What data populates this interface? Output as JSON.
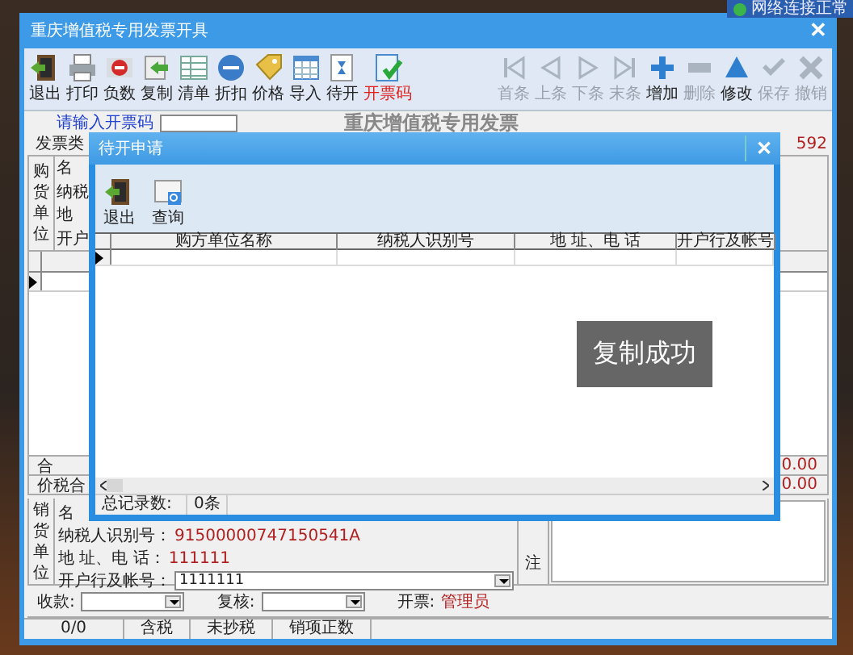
{
  "notification": {
    "text": "网络连接正常"
  },
  "main_window": {
    "title": "重庆增值税专用发票开具",
    "close_label": "✕",
    "toolbar": [
      {
        "label": "退出",
        "kind": "exit"
      },
      {
        "label": "打印",
        "kind": "print"
      },
      {
        "label": "负数",
        "kind": "negative"
      },
      {
        "label": "复制",
        "kind": "copy"
      },
      {
        "label": "清单",
        "kind": "list"
      },
      {
        "label": "折扣",
        "kind": "discount"
      },
      {
        "label": "价格",
        "kind": "price"
      },
      {
        "label": "导入",
        "kind": "import"
      },
      {
        "label": "待开",
        "kind": "pending"
      },
      {
        "label": "开票码",
        "kind": "code"
      }
    ],
    "nav": [
      {
        "label": "首条",
        "kind": "first",
        "disabled": true
      },
      {
        "label": "上条",
        "kind": "prev",
        "disabled": true
      },
      {
        "label": "下条",
        "kind": "next",
        "disabled": true
      },
      {
        "label": "末条",
        "kind": "last",
        "disabled": true
      },
      {
        "label": "增加",
        "kind": "add",
        "disabled": false
      },
      {
        "label": "删除",
        "kind": "delete",
        "disabled": true
      },
      {
        "label": "修改",
        "kind": "edit",
        "disabled": false
      },
      {
        "label": "保存",
        "kind": "save",
        "disabled": true
      },
      {
        "label": "撤销",
        "kind": "cancel",
        "disabled": true
      }
    ]
  },
  "invoice": {
    "heading": "重庆增值税专用发票",
    "code_label": "请输入开票码",
    "type_label": "发票类",
    "number_fragment": "592",
    "buyer": {
      "side_label": "购货单位",
      "fields": [
        "名",
        "纳税",
        "地",
        "开户"
      ]
    },
    "total": {
      "label": "合",
      "value": "0.00"
    },
    "tax_total": {
      "label": "价税合",
      "value": "0.00"
    },
    "seller": {
      "side_label": "销货单位",
      "name_label": "名",
      "fields": [
        {
          "label": "纳税人识别号：",
          "value": "91500000747150541A",
          "kind": "text"
        },
        {
          "label": "地 址、电 话：",
          "value": "111111",
          "kind": "text"
        },
        {
          "label": "开户行及帐号：",
          "value": "1111111",
          "kind": "select"
        }
      ]
    },
    "remarks_label": "注",
    "footer": {
      "payee_label": "收款:",
      "reviewer_label": "复核:",
      "issuer_label": "开票:",
      "issuer": "管理员"
    },
    "status_bar": [
      "0/0",
      "含税",
      "未抄税",
      "销项正数"
    ]
  },
  "dialog": {
    "title": "待开申请",
    "close_label": "✕",
    "toolbar": [
      {
        "label": "退出",
        "kind": "exit"
      },
      {
        "label": "查询",
        "kind": "query"
      }
    ],
    "columns": [
      "购方单位名称",
      "纳税人识别号",
      "地 址、电 话",
      "开户行及帐号"
    ],
    "record_label": "总记录数:",
    "record_count": "0条"
  },
  "toast": {
    "text": "复制成功"
  }
}
